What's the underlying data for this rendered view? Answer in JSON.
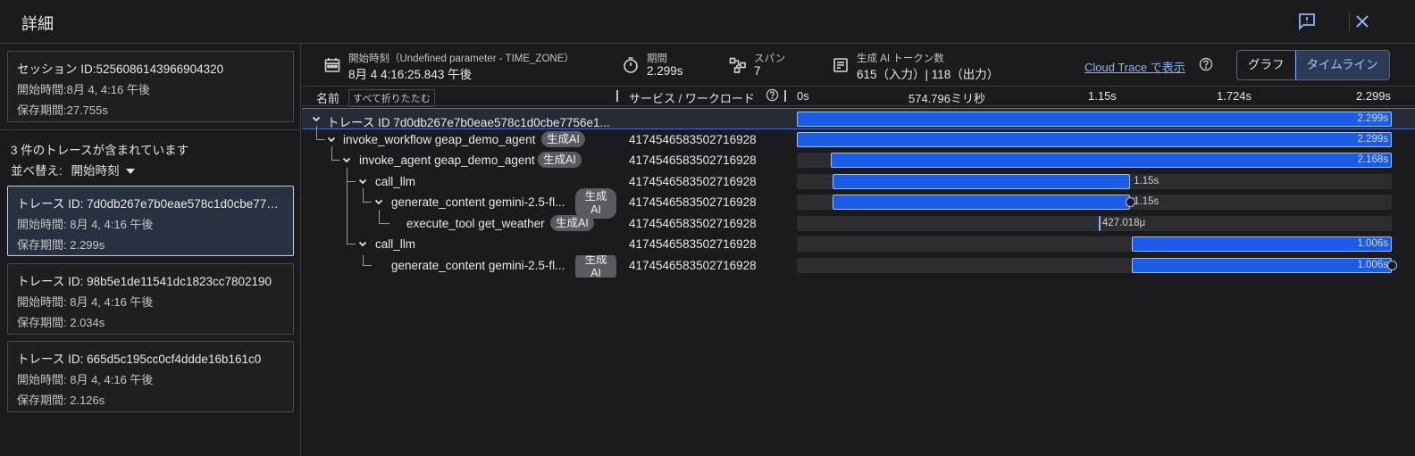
{
  "header": {
    "title": "詳細"
  },
  "left": {
    "session": {
      "title": "セッション ID:5256086143966904320",
      "start": "開始時間:8月 4, 4:16 午後",
      "retention": "保存期間:27.755s"
    },
    "count_text": "3 件のトレースが含まれています",
    "sort_label": "並べ替え:",
    "sort_value": "開始時刻",
    "traces": [
      {
        "title": "トレース ID: 7d0db267e7b0eae578c1d0cbe7756e1",
        "start": "開始時間: 8月 4, 4:16 午後",
        "retention": "保存期間: 2.299s"
      },
      {
        "title": "トレース ID: 98b5e1de11541dc1823cc7802190",
        "start": "開始時間: 8月 4, 4:16 午後",
        "retention": "保存期間: 2.034s"
      },
      {
        "title": "トレース ID: 665d5c195cc0cf4ddde16b161c0",
        "start": "開始時間: 8月 4, 4:16 午後",
        "retention": "保存期間: 2.126s"
      }
    ]
  },
  "summary": {
    "start_label": "開始時刻（Undefined parameter - TIME_ZONE）",
    "start_value": "8月 4 4:16:25.843 午後",
    "duration_label": "期間",
    "duration_value": "2.299s",
    "span_label": "スパン",
    "span_value": "7",
    "tokens_label": "生成 AI トークン数",
    "tokens_value": "615（入力）| 118（出力）",
    "cloud_trace_link": "Cloud Trace で表示",
    "view_graph": "グラフ",
    "view_timeline": "タイムライン"
  },
  "columns": {
    "name": "名前",
    "collapse_all": "すべて折りたたむ",
    "service": "サービス / ワークロード",
    "ticks": [
      "0s",
      "574.796ミリ秒",
      "1.15s",
      "1.724s",
      "2.299s"
    ]
  },
  "timeline": {
    "total_s": 2.299
  },
  "spans": [
    {
      "name": "トレース ID 7d0db267e7b0eae578c1d0cbe7756e1...",
      "badge": "",
      "service": "",
      "start_s": 0,
      "dur_s": 2.299,
      "dur_label": "2.299s"
    },
    {
      "name": "invoke_workflow geap_demo_agent",
      "badge": "生成AI",
      "service": "4174546583502716928",
      "start_s": 0,
      "dur_s": 2.299,
      "dur_label": "2.299s"
    },
    {
      "name": "invoke_agent geap_demo_agent",
      "badge": "生成AI",
      "service": "4174546583502716928",
      "start_s": 0.131,
      "dur_s": 2.168,
      "dur_label": "2.168s"
    },
    {
      "name": "call_llm",
      "badge": "",
      "service": "4174546583502716928",
      "start_s": 0.138,
      "dur_s": 1.15,
      "dur_label": "1.15s"
    },
    {
      "name": "generate_content gemini-2.5-fl...",
      "badge": "生成AI",
      "service": "4174546583502716928",
      "start_s": 0.138,
      "dur_s": 1.15,
      "dur_label": "1.15s"
    },
    {
      "name": "execute_tool get_weather",
      "badge": "生成AI",
      "service": "4174546583502716928",
      "start_s": 1.166,
      "dur_s": 0.000427,
      "dur_label": "427.018μ"
    },
    {
      "name": "call_llm",
      "badge": "",
      "service": "4174546583502716928",
      "start_s": 1.293,
      "dur_s": 1.006,
      "dur_label": "1.006s"
    },
    {
      "name": "generate_content gemini-2.5-fl...",
      "badge": "生成AI",
      "service": "4174546583502716928",
      "start_s": 1.293,
      "dur_s": 1.006,
      "dur_label": "1.006s"
    }
  ]
}
